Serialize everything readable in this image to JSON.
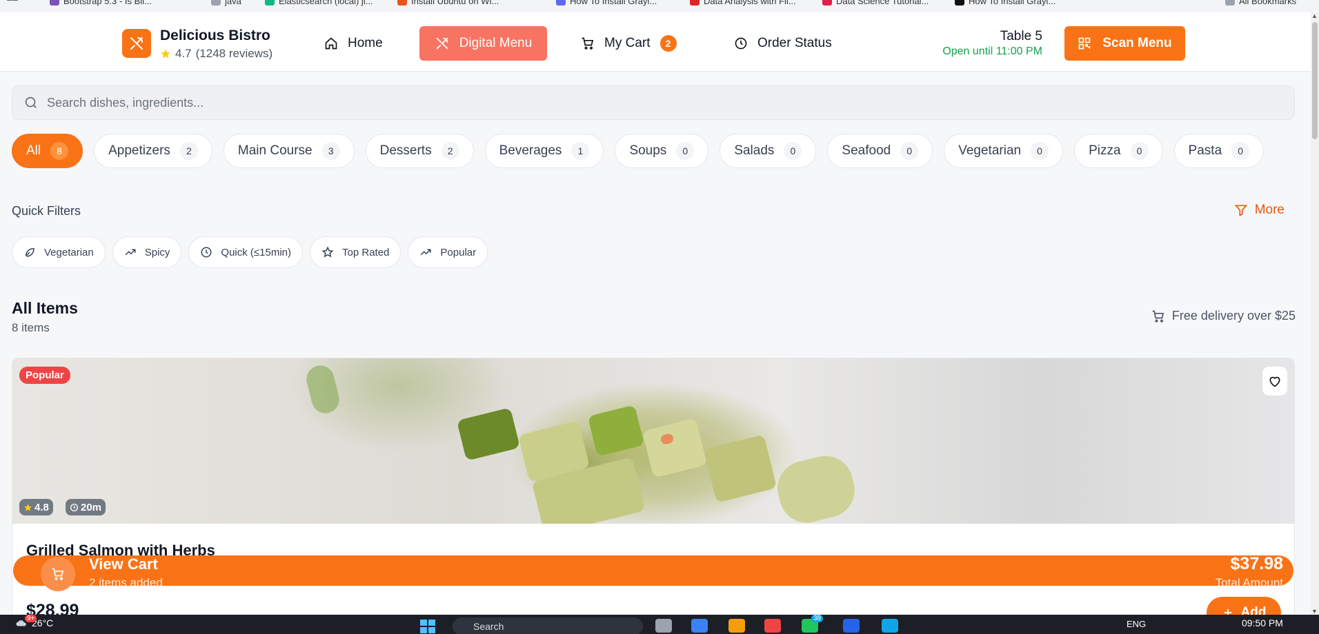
{
  "bookmarks": [
    {
      "label": "Bootstrap 5.3 - Is Bil...",
      "color": "#7952b3"
    },
    {
      "label": "java",
      "color": "#9ca3af"
    },
    {
      "label": "Elasticsearch (local) ji...",
      "color": "#10b981"
    },
    {
      "label": "Install Ubuntu on Wi...",
      "color": "#e95420"
    },
    {
      "label": "How To Install Grayl...",
      "color": "#6366f1"
    },
    {
      "label": "Data Analysis with Fil...",
      "color": "#dc2626"
    },
    {
      "label": "Data Science Tutorial...",
      "color": "#e11d48"
    },
    {
      "label": "How To Install Grayl...",
      "color": "#111111"
    },
    {
      "label": "All Bookmarks",
      "color": "#9ca3af"
    }
  ],
  "header": {
    "brand_name": "Delicious Bistro",
    "rating": "4.7",
    "reviews": "(1248 reviews)",
    "nav": {
      "home": "Home",
      "digital_menu": "Digital Menu",
      "cart": "My Cart",
      "cart_count": "2",
      "order_status": "Order Status"
    },
    "table": "Table 5",
    "open_until": "Open until 11:00 PM",
    "scan_menu": "Scan Menu"
  },
  "search": {
    "placeholder": "Search dishes, ingredients..."
  },
  "categories": [
    {
      "label": "All",
      "count": "8",
      "active": true
    },
    {
      "label": "Appetizers",
      "count": "2"
    },
    {
      "label": "Main Course",
      "count": "3"
    },
    {
      "label": "Desserts",
      "count": "2"
    },
    {
      "label": "Beverages",
      "count": "1"
    },
    {
      "label": "Soups",
      "count": "0"
    },
    {
      "label": "Salads",
      "count": "0"
    },
    {
      "label": "Seafood",
      "count": "0"
    },
    {
      "label": "Vegetarian",
      "count": "0"
    },
    {
      "label": "Pizza",
      "count": "0"
    },
    {
      "label": "Pasta",
      "count": "0"
    }
  ],
  "quick_filters": {
    "title": "Quick Filters",
    "more": "More",
    "items": [
      {
        "label": "Vegetarian",
        "icon": "leaf-icon"
      },
      {
        "label": "Spicy",
        "icon": "trending-up-icon"
      },
      {
        "label": "Quick (≤15min)",
        "icon": "clock-icon"
      },
      {
        "label": "Top Rated",
        "icon": "star-icon"
      },
      {
        "label": "Popular",
        "icon": "trending-up-icon"
      }
    ]
  },
  "items_section": {
    "title": "All Items",
    "count": "8 items",
    "delivery": "Free delivery over $25"
  },
  "dish": {
    "badge": "Popular",
    "rating": "4.8",
    "time": "20m",
    "name": "Grilled Salmon with Herbs",
    "price": "$28.99",
    "add_label": "Add"
  },
  "cart_bar": {
    "title": "View Cart",
    "subtitle": "2 items added",
    "total": "$37.98",
    "total_label": "Total Amount"
  },
  "taskbar": {
    "notifications": "9+",
    "temperature": "26°C",
    "search_placeholder": "Search",
    "lang": "ENG",
    "time": "09:50 PM",
    "app_badge": "38"
  },
  "colors": {
    "accent": "#f97316",
    "active_nav": "#f97362",
    "popular_badge": "#ef4444",
    "open_status": "#16a34a"
  }
}
